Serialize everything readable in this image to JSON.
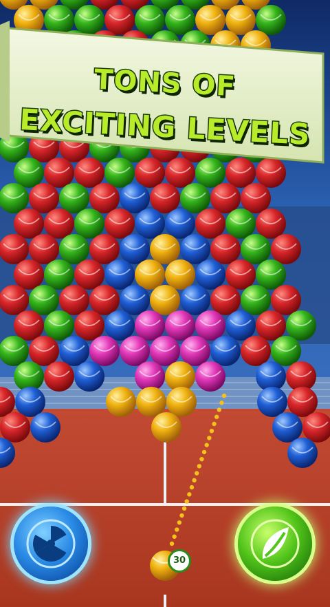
{
  "banner": {
    "line1": "TONS OF",
    "line2": "EXCITING LEVELS"
  },
  "launcher": {
    "shots_left": "30"
  },
  "left_button": {
    "icon": "radiation-bomb-icon"
  },
  "right_button": {
    "icon": "leaf-fire-icon"
  },
  "colors": {
    "red": "#d8262a",
    "green": "#35b51c",
    "blue": "#1f5fd6",
    "yellow": "#f0b20f",
    "pink": "#e238b8",
    "court": "#c84a32",
    "banner": "#e9f2cc",
    "banner_text": "#b8ec2a"
  }
}
